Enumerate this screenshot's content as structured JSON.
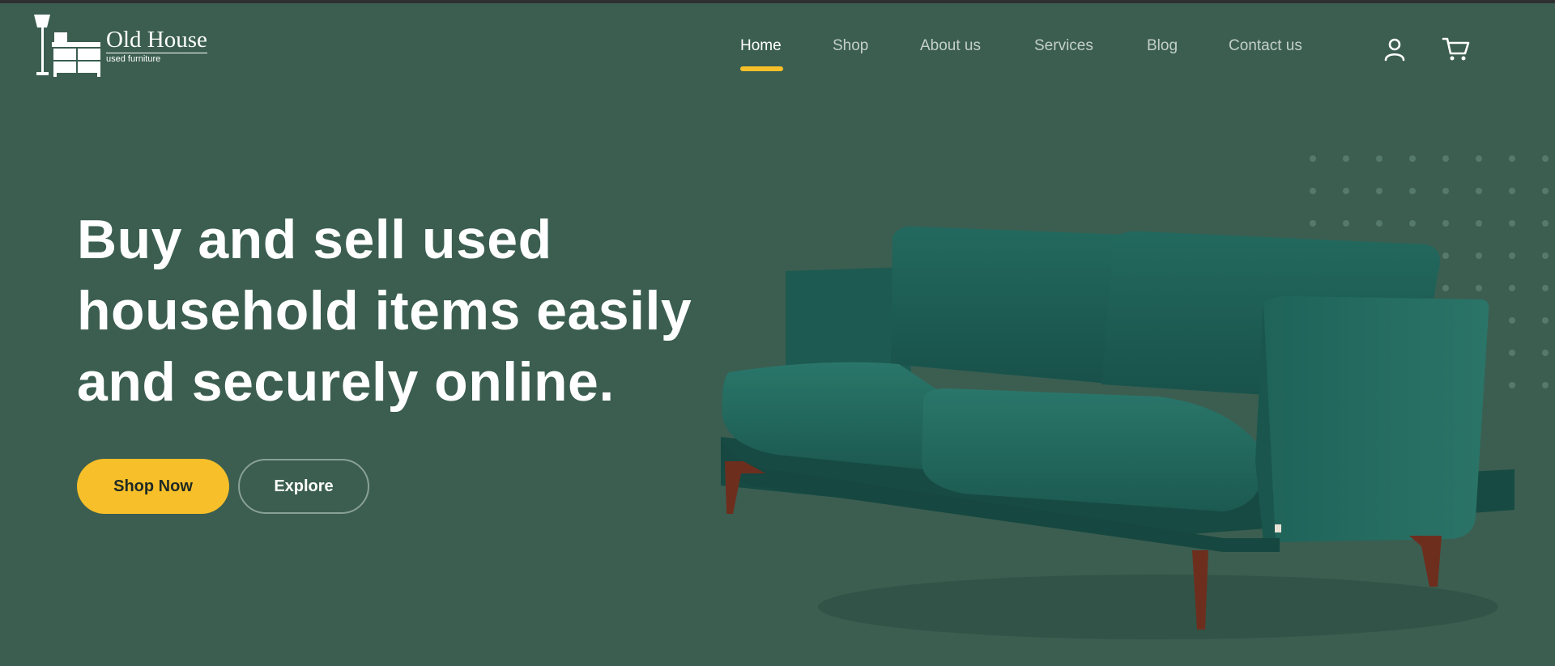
{
  "brand": {
    "name": "Old House",
    "tagline": "used furniture"
  },
  "nav": {
    "items": [
      {
        "label": "Home",
        "active": true
      },
      {
        "label": "Shop",
        "active": false
      },
      {
        "label": "About us",
        "active": false
      },
      {
        "label": "Services",
        "active": false
      },
      {
        "label": "Blog",
        "active": false
      },
      {
        "label": "Contact us",
        "active": false
      }
    ],
    "icons": [
      "user-icon",
      "cart-icon"
    ]
  },
  "hero": {
    "title_lines": [
      "Buy and sell used",
      "household items easily",
      "and securely online."
    ],
    "primary_button": "Shop Now",
    "secondary_button": "Explore"
  },
  "colors": {
    "background": "#3b5e51",
    "accent": "#f7bf29",
    "sofa": "#1f5e54"
  }
}
